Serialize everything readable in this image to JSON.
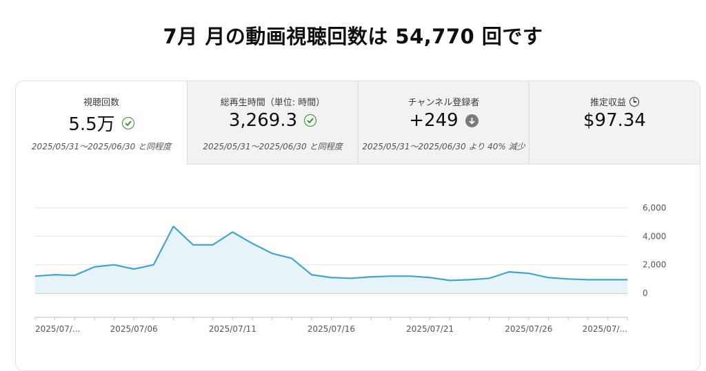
{
  "headline": "7月 月の動画視聴回数は 54,770 回です",
  "tabs": [
    {
      "label": "視聴回数",
      "value": "5.5万",
      "status_icon": "check-circle-icon",
      "note": "2025/05/31〜2025/06/30 と同程度",
      "active": true
    },
    {
      "label": "総再生時間（単位: 時間）",
      "value": "3,269.3",
      "status_icon": "check-circle-icon",
      "note": "2025/05/31〜2025/06/30 と同程度",
      "active": false
    },
    {
      "label": "チャンネル登録者",
      "value": "+249",
      "status_icon": "arrow-down-circle-icon",
      "note": "2025/05/31〜2025/06/30 より 40% 減少",
      "active": false
    },
    {
      "label": "推定収益",
      "label_icon": "clock-icon",
      "value": "$97.34",
      "note": "",
      "active": false
    }
  ],
  "colors": {
    "line": "#41a4cf",
    "fill": "#e6f3f8",
    "check": "#2e8b2e",
    "down": "#7a7a7a"
  },
  "chart_data": {
    "type": "area",
    "series": [
      {
        "values": [
          1200,
          1300,
          1250,
          1850,
          2000,
          1700,
          2000,
          4700,
          3400,
          3400,
          4300,
          3500,
          2800,
          2450,
          1300,
          1100,
          1050,
          1150,
          1200,
          1200,
          1100,
          900,
          950,
          1050,
          1500,
          1400,
          1100,
          1000,
          950,
          950,
          950
        ]
      }
    ],
    "x_tick_labels": [
      "2025/07/...",
      "2025/07/06",
      "2025/07/11",
      "2025/07/16",
      "2025/07/21",
      "2025/07/26",
      "2025/07/..."
    ],
    "y_tick_labels": [
      "6,000",
      "4,000",
      "2,000",
      "0"
    ],
    "y_ticks": [
      6000,
      4000,
      2000,
      0
    ],
    "ylim": [
      0,
      6000
    ],
    "grid": true
  }
}
